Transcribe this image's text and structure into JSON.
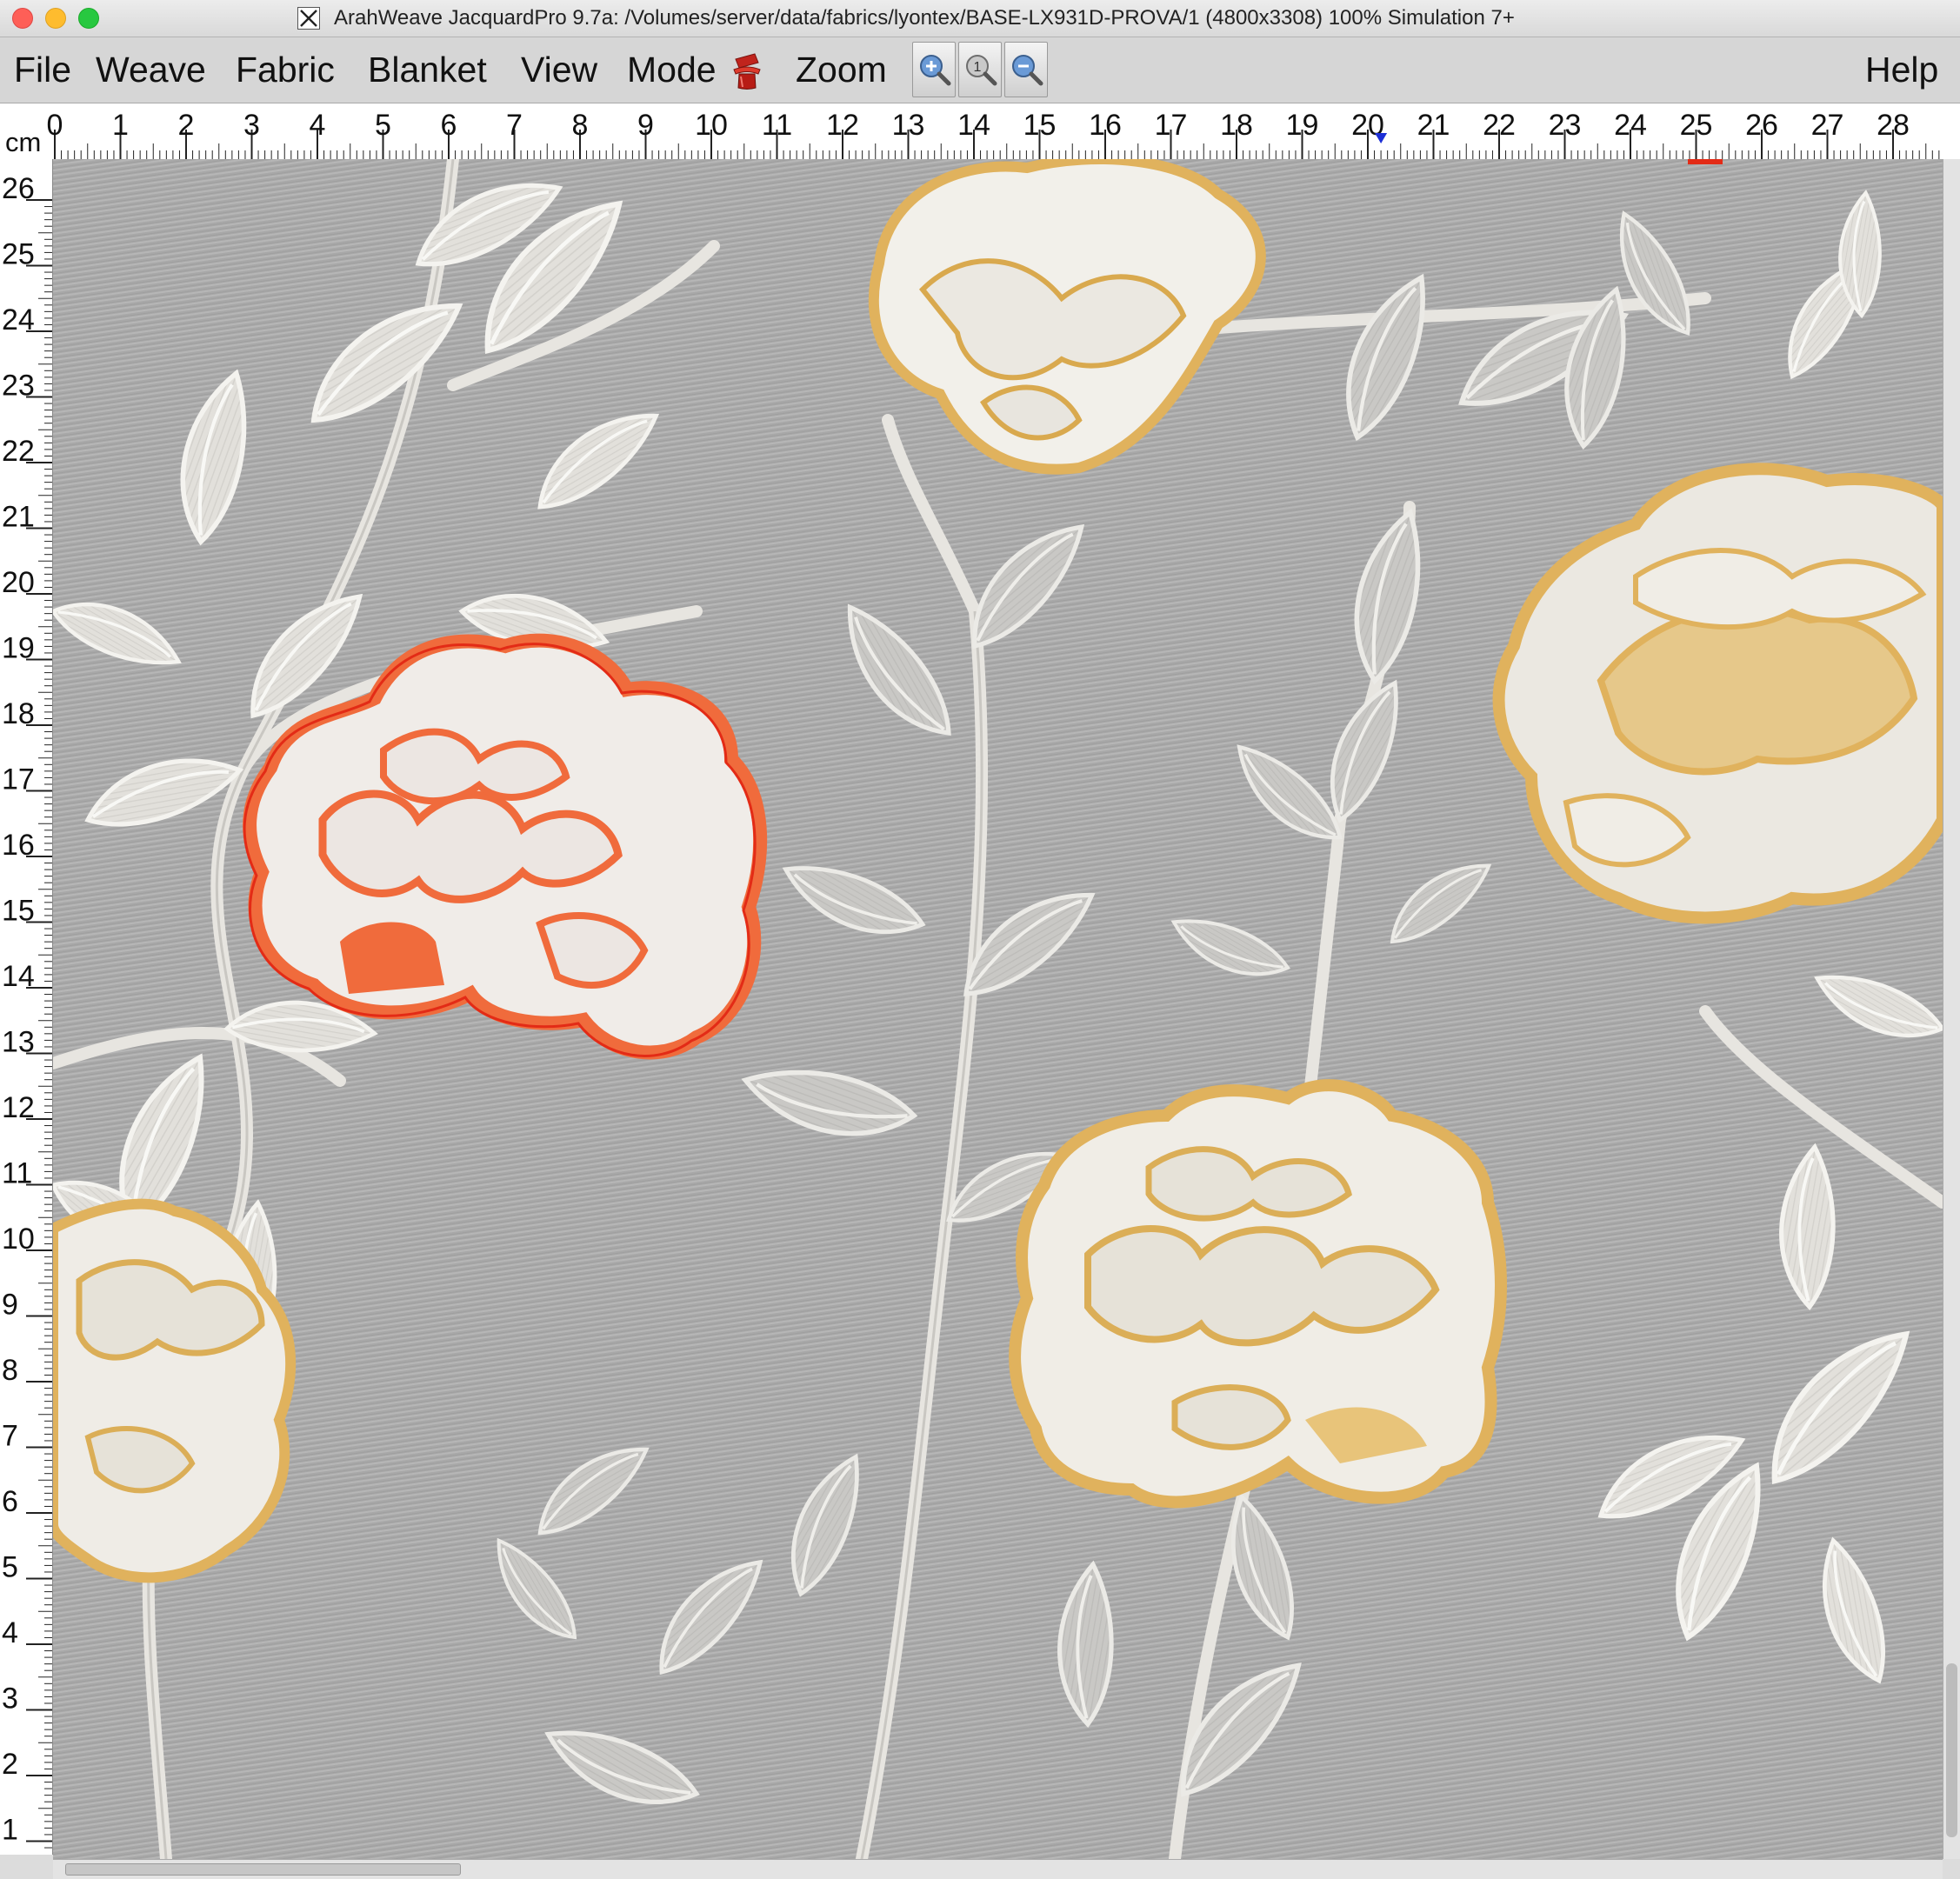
{
  "window": {
    "title": "ArahWeave JacquardPro 9.7a: /Volumes/server/data/fabrics/lyontex/BASE-LX931D-PROVA/1 (4800x3308) 100% Simulation 7+"
  },
  "menu": {
    "items": [
      {
        "id": "file",
        "label": "File"
      },
      {
        "id": "weave",
        "label": "Weave"
      },
      {
        "id": "fabric",
        "label": "Fabric"
      },
      {
        "id": "blanket",
        "label": "Blanket"
      },
      {
        "id": "view",
        "label": "View"
      },
      {
        "id": "mode",
        "label": "Mode"
      },
      {
        "id": "zoom",
        "label": "Zoom"
      }
    ],
    "help": "Help",
    "mode_icon": "magic-hat-icon",
    "zoom_buttons": [
      "zoom-in-icon",
      "zoom-actual-icon",
      "zoom-out-icon"
    ]
  },
  "ruler": {
    "unit": "cm",
    "top_ticks": [
      "0",
      "1",
      "2",
      "3",
      "4",
      "5",
      "6",
      "7",
      "8",
      "9",
      "10",
      "11",
      "12",
      "13",
      "14",
      "15",
      "16",
      "17",
      "18",
      "19",
      "20",
      "21",
      "22",
      "23",
      "24",
      "25",
      "26",
      "27",
      "28"
    ],
    "left_ticks": [
      "26",
      "25",
      "24",
      "23",
      "22",
      "21",
      "20",
      "19",
      "18",
      "17",
      "16",
      "15",
      "14",
      "13",
      "12",
      "11",
      "10",
      "9",
      "8",
      "7",
      "6",
      "5",
      "4",
      "3",
      "2",
      "1"
    ],
    "marker_position_cm": 20.2
  },
  "fabric": {
    "background": "#a8a8a8",
    "leaf_color": "#e6e4df",
    "flower_fill": "#f1efe9",
    "gold": "#e0b25d",
    "orange": "#f06b3c",
    "red": "#e32b16"
  }
}
